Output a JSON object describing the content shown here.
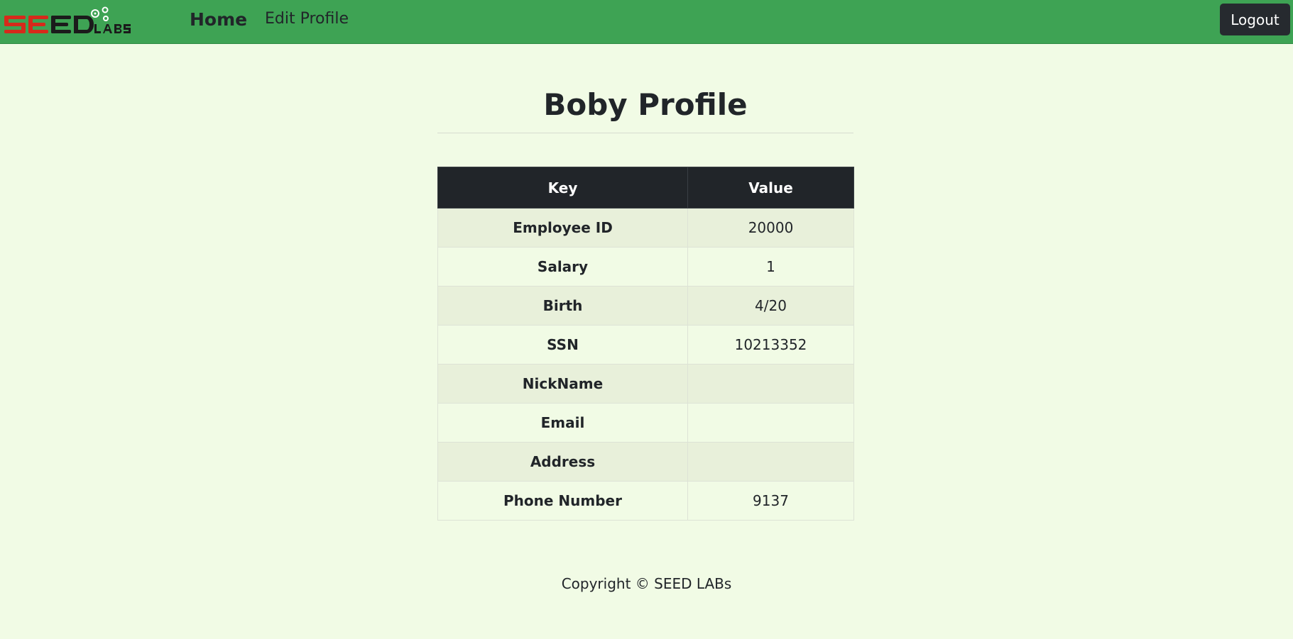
{
  "nav": {
    "logo_alt": "SEED LABs",
    "home_label": "Home",
    "edit_profile_label": "Edit Profile",
    "logout_label": "Logout"
  },
  "page": {
    "title": "Boby Profile"
  },
  "table": {
    "headers": [
      "Key",
      "Value"
    ],
    "rows": [
      {
        "key": "Employee ID",
        "value": "20000"
      },
      {
        "key": "Salary",
        "value": "1"
      },
      {
        "key": "Birth",
        "value": "4/20"
      },
      {
        "key": "SSN",
        "value": "10213352"
      },
      {
        "key": "NickName",
        "value": ""
      },
      {
        "key": "Email",
        "value": ""
      },
      {
        "key": "Address",
        "value": ""
      },
      {
        "key": "Phone Number",
        "value": "9137"
      }
    ]
  },
  "footer": {
    "copyright": "Copyright © SEED LABs"
  },
  "colors": {
    "navbar_bg": "#3ea354",
    "page_bg": "#f1fbe5",
    "header_bg": "#212529",
    "logo_red": "#d62a1b",
    "logo_dark": "#1b1b1b"
  }
}
